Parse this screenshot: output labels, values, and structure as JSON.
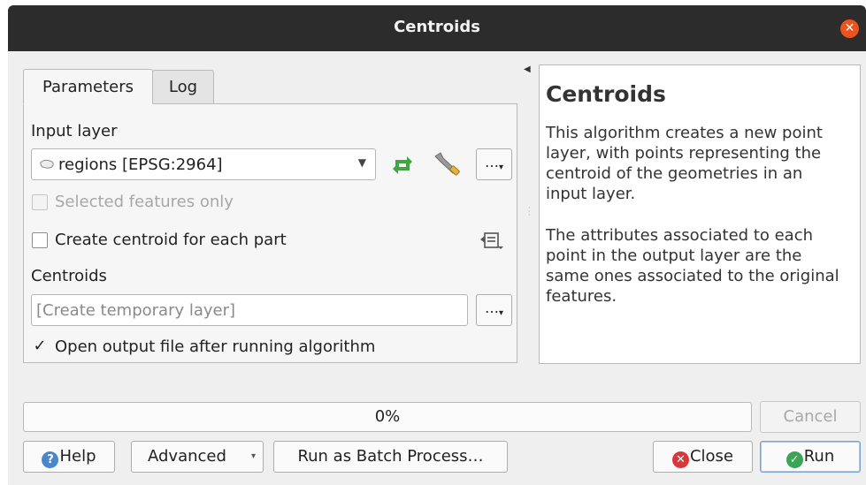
{
  "window": {
    "title": "Centroids"
  },
  "tabs": [
    "Parameters",
    "Log"
  ],
  "params": {
    "input_layer_label": "Input layer",
    "input_layer_value": "regions [EPSG:2964]",
    "selected_only_label": "Selected features only",
    "selected_only_checked": false,
    "each_part_label": "Create centroid for each part",
    "each_part_checked": false,
    "centroids_label": "Centroids",
    "centroids_placeholder": "[Create temporary layer]",
    "open_output_label": "Open output file after running algorithm",
    "open_output_checked": true,
    "browse_label": "…"
  },
  "help": {
    "title": "Centroids",
    "para1": "This algorithm creates a new point layer, with points representing the centroid of the geometries in an input layer.",
    "para2": "The attributes associated to each point in the output layer are the same ones associated to the original features."
  },
  "progress": {
    "text": "0%",
    "value": 0
  },
  "buttons": {
    "cancel": "Cancel",
    "help": "Help",
    "advanced": "Advanced",
    "batch": "Run as Batch Process…",
    "close": "Close",
    "run": "Run"
  },
  "colors": {
    "titlebar": "#2c2c2c",
    "close_orange": "#e95420",
    "help_blue": "#4a86c8",
    "close_red": "#d9383a",
    "run_green": "#3aa655",
    "icon_green": "#41a541"
  }
}
